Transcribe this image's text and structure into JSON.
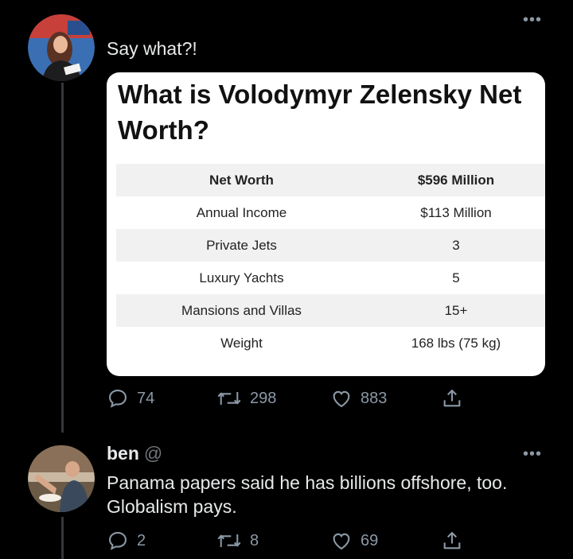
{
  "tweet1": {
    "text": "Say what?!",
    "card": {
      "title": "What is Volodymyr Zelensky Net Worth?",
      "rows": [
        {
          "label": "Net Worth",
          "value": "$596 Million"
        },
        {
          "label": "Annual Income",
          "value": "$113 Million"
        },
        {
          "label": "Private Jets",
          "value": "3"
        },
        {
          "label": "Luxury Yachts",
          "value": "5"
        },
        {
          "label": "Mansions and Villas",
          "value": "15+"
        },
        {
          "label": "Weight",
          "value": "168 lbs (75 kg)"
        }
      ]
    },
    "actions": {
      "replies": "74",
      "retweets": "298",
      "likes": "883"
    }
  },
  "tweet2": {
    "name": "ben",
    "handle": "@",
    "text": "Panama papers said he has billions offshore, too. Globalism pays.",
    "actions": {
      "replies": "2",
      "retweets": "8",
      "likes": "69"
    }
  },
  "icons": {
    "reply": "reply-icon",
    "retweet": "retweet-icon",
    "like": "heart-icon",
    "share": "share-icon",
    "more": "more-icon"
  },
  "colors": {
    "background": "#000000",
    "text": "#e7e9ea",
    "muted": "#8b98a5",
    "card": "#ffffff"
  }
}
